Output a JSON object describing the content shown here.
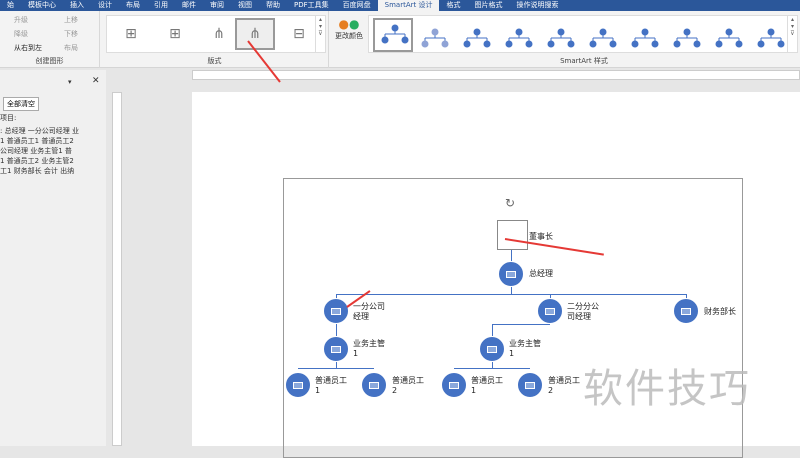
{
  "tabs": [
    "始",
    "模板中心",
    "插入",
    "设计",
    "布局",
    "引用",
    "邮件",
    "审阅",
    "视图",
    "帮助",
    "PDF工具集",
    "百度网盘",
    "SmartArt 设计",
    "格式",
    "图片格式",
    "操作说明搜索"
  ],
  "ribbon": {
    "create_graphic": {
      "promote": "升级",
      "demote": "降级",
      "move_up": "上移",
      "move_down": "下移",
      "rtl": "从右到左",
      "layout": "布局",
      "label": "创建图形"
    },
    "layouts_label": "版式",
    "change_colors": "更改颜色",
    "styles_label": "SmartArt 样式"
  },
  "pane": {
    "clear_all": "全部清空",
    "items_label": "项目:",
    "lines": [
      ": 总经理 一分公司经理 业",
      "1 普通员工1 普通员工2",
      "公司经理 业务主管1 普",
      "1 普通员工2 业务主管2",
      "工1 财务部长 会计 出纳"
    ]
  },
  "chart": {
    "n0": "董事长",
    "n1": "总经理",
    "n2a": "一分公司\n经理",
    "n2b": "二分分公\n司经理",
    "n2c": "财务部长",
    "n3a": "业务主管\n1",
    "n3b": "业务主管\n1",
    "n4a": "普通员工\n1",
    "n4b": "普通员工\n2",
    "n4c": "普通员工\n1",
    "n4d": "普通员工\n2"
  },
  "watermark": "软件技巧",
  "colors": {
    "accent": "#2b579a",
    "node": "#4472c4",
    "arrow": "#e53935"
  }
}
